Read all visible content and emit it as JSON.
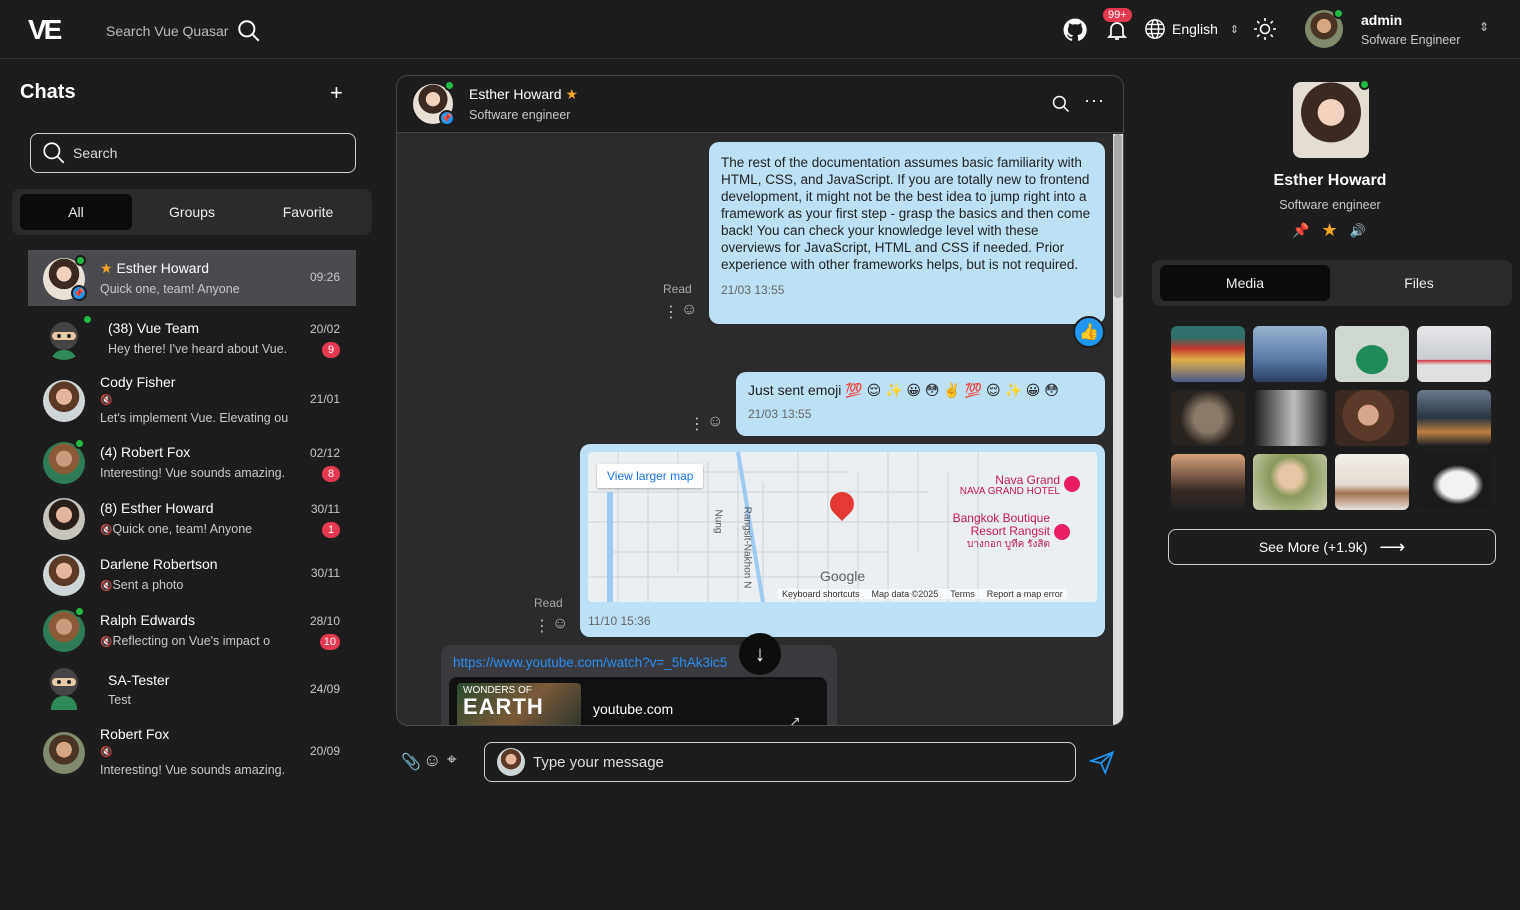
{
  "topbar": {
    "logo": "VE",
    "search_placeholder": "Search Vue Quasar",
    "notifications_badge": "99+",
    "language": "English",
    "user_name": "admin",
    "user_role": "Sofware Engineer"
  },
  "left": {
    "title": "Chats",
    "search_placeholder": "Search",
    "tabs": [
      "All",
      "Groups",
      "Favorite"
    ],
    "chats": [
      {
        "name": "Esther Howard",
        "msg": "Quick one, team! Anyone",
        "time": "09:26",
        "count": ""
      },
      {
        "name": "(38) Vue Team",
        "msg": "Hey there! I've heard about Vue.",
        "time": "20/02",
        "count": "9"
      },
      {
        "name": "Cody Fisher",
        "msg": "Let's implement Vue. Elevating ou",
        "time": "21/01",
        "count": ""
      },
      {
        "name": "(4) Robert Fox",
        "msg": "Interesting! Vue sounds amazing.",
        "time": "02/12",
        "count": "8"
      },
      {
        "name": "(8) Esther Howard",
        "msg": "Quick one, team! Anyone",
        "time": "30/11",
        "count": "1"
      },
      {
        "name": "Darlene Robertson",
        "msg": "Sent a photo",
        "time": "30/11",
        "count": ""
      },
      {
        "name": "Ralph Edwards",
        "msg": "Reflecting on Vue's impact o",
        "time": "28/10",
        "count": "10"
      },
      {
        "name": "SA-Tester",
        "msg": "Test",
        "time": "24/09",
        "count": ""
      },
      {
        "name": "Robert Fox",
        "msg": "Interesting! Vue sounds amazing.",
        "time": "20/09",
        "count": ""
      }
    ]
  },
  "center": {
    "contact_name": "Esther Howard",
    "contact_role": "Software engineer",
    "messages": {
      "m1_text": "The rest of the documentation assumes basic familiarity with HTML, CSS, and JavaScript. If you are totally new to frontend development, it might not be the best idea to jump right into a framework as your first step - grasp the basics and then come back! You can check your knowledge level with these overviews for JavaScript, HTML and CSS if needed. Prior experience with other frameworks helps, but is not required.",
      "m1_time": "21/03 13:55",
      "m2_text": "Just sent emoji 💯 😌 ✨ 😀 😳 ✌️ 💯 😌 ✨ 😀 😳",
      "m2_time": "21/03 13:55",
      "m3_time": "11/10 15:36",
      "read_label": "Read",
      "map_link": "View larger map",
      "map_place1": "Nava Grand",
      "map_place1_sub": "NAVA GRAND HOTEL",
      "map_place2": "Bangkok Boutique Resort Rangsit",
      "map_place2_sub": "บางกอก บูทีค รังสิต",
      "map_road1": "Rangsit-Nakhon N",
      "map_road2": "Nung",
      "map_logo": "Google",
      "map_footer": [
        "Keyboard shortcuts",
        "Map data ©2025",
        "Terms",
        "Report a map error"
      ],
      "m4_link": "https://www.youtube.com/watch?v=_5hAk3ic5",
      "m4_site": "youtube.com",
      "m4_thumb_small": "WONDERS OF",
      "m4_thumb_big": "EARTH"
    },
    "input_placeholder": "Type your message"
  },
  "right": {
    "name": "Esther Howard",
    "role": "Software engineer",
    "tabs": [
      "Media",
      "Files"
    ],
    "see_more": "See More (+1.9k)"
  },
  "colors": {
    "bubble": "#bde0f5",
    "badge": "#e53950",
    "online": "#21ba45",
    "accent": "#2196f3"
  }
}
